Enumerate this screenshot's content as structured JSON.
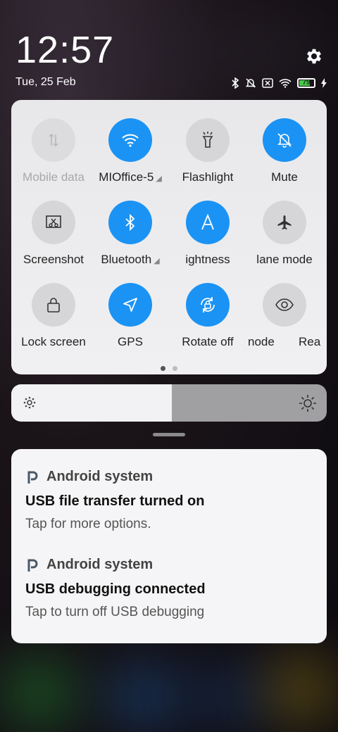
{
  "status": {
    "time": "12:57",
    "date": "Tue, 25 Feb",
    "battery_level": "79",
    "battery_fraction": 0.79,
    "icons": [
      "bluetooth-icon",
      "mute-icon",
      "no-sim-icon",
      "wifi-icon",
      "battery-icon",
      "charging-icon"
    ]
  },
  "quick_settings": {
    "tiles": [
      {
        "label": "Mobile data",
        "state": "disabled",
        "icon": "mobile-data-icon"
      },
      {
        "label": "MIOffice-5",
        "state": "on",
        "icon": "wifi-icon"
      },
      {
        "label": "Flashlight",
        "state": "off",
        "icon": "flashlight-icon"
      },
      {
        "label": "Mute",
        "state": "on",
        "icon": "mute-icon"
      },
      {
        "label": "Screenshot",
        "state": "off",
        "icon": "screenshot-icon"
      },
      {
        "label": "Bluetooth",
        "state": "on",
        "icon": "bluetooth-icon"
      },
      {
        "label": "ightness",
        "state": "on",
        "icon": "auto-brightness-icon"
      },
      {
        "label": "lane mode",
        "state": "off",
        "icon": "airplane-icon"
      },
      {
        "label": "Lock screen",
        "state": "off",
        "icon": "lock-icon"
      },
      {
        "label": "GPS",
        "state": "on",
        "icon": "gps-icon"
      },
      {
        "label": "Rotate off",
        "state": "on",
        "icon": "rotate-lock-icon"
      },
      {
        "label": "node",
        "state": "off",
        "icon": "reading-mode-icon"
      },
      {
        "label": "Rea",
        "state": "partial",
        "icon": ""
      }
    ],
    "page_count": 2,
    "active_page": 1
  },
  "brightness": {
    "level": 0.51
  },
  "notifications": [
    {
      "app": "Android system",
      "title": "USB file transfer turned on",
      "body": "Tap for more options."
    },
    {
      "app": "Android system",
      "title": "USB debugging connected",
      "body": "Tap to turn off USB debugging"
    }
  ],
  "colors": {
    "accent": "#1b93f5",
    "tile_off": "#d6d6d8",
    "battery": "#48c84a"
  }
}
